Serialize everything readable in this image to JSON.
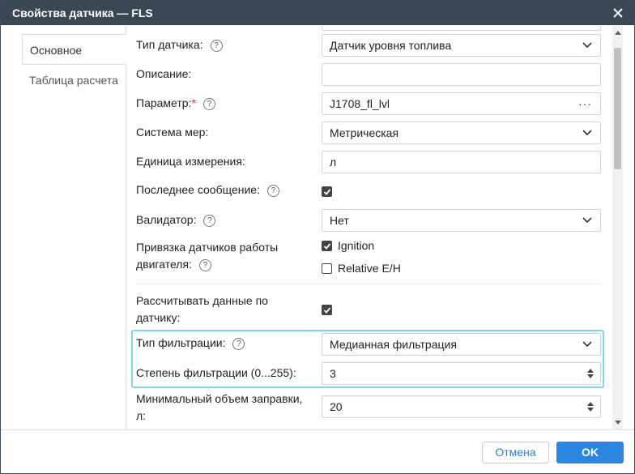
{
  "dialog": {
    "title": "Свойства датчика — FLS"
  },
  "tabs": [
    {
      "label": "Основное",
      "active": true
    },
    {
      "label": "Таблица расчета",
      "active": false
    }
  ],
  "form": {
    "sensor_type": {
      "label": "Тип датчика:",
      "value": "Датчик уровня топлива"
    },
    "description": {
      "label": "Описание:",
      "value": ""
    },
    "parameter": {
      "label": "Параметр:",
      "required_mark": "*",
      "value": "J1708_fl_lvl",
      "more": "···"
    },
    "unit_system": {
      "label": "Система мер:",
      "value": "Метрическая"
    },
    "unit": {
      "label": "Единица измерения:",
      "value": "л"
    },
    "last_message": {
      "label": "Последнее сообщение:",
      "checked": true
    },
    "validator": {
      "label": "Валидатор:",
      "value": "Нет"
    },
    "engine_binding": {
      "label_line1": "Привязка датчиков работы",
      "label_line2": "двигателя:",
      "options": [
        {
          "label": "Ignition",
          "checked": true
        },
        {
          "label": "Relative E/H",
          "checked": false
        }
      ]
    },
    "calc_by_sensor": {
      "label_line1": "Рассчитывать данные по",
      "label_line2": "датчику:",
      "checked": true
    },
    "filter_type": {
      "label": "Тип фильтрации:",
      "value": "Медианная фильтрация"
    },
    "filter_degree": {
      "label": "Степень фильтрации (0...255):",
      "value": "3"
    },
    "min_refill": {
      "label_line1": "Минимальный объем заправки,",
      "label_line2": "л:",
      "value": "20"
    }
  },
  "help_glyph": "?",
  "footer": {
    "cancel_label": "Отмена",
    "ok_label": "OK"
  },
  "colors": {
    "titlebar": "#3b4753",
    "accent": "#2a86e0",
    "highlight": "#7fd8dc",
    "required": "#e0262e"
  }
}
